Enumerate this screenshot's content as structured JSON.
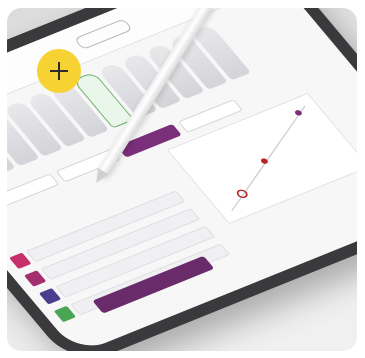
{
  "photo": {
    "subject": "",
    "colors": {
      "badge": "#f6d232",
      "accent": "#7a2f7a",
      "selected_tooth": "#5da65d",
      "background": "#e6e6e6"
    }
  },
  "badge": {
    "icon": "plus-icon"
  }
}
